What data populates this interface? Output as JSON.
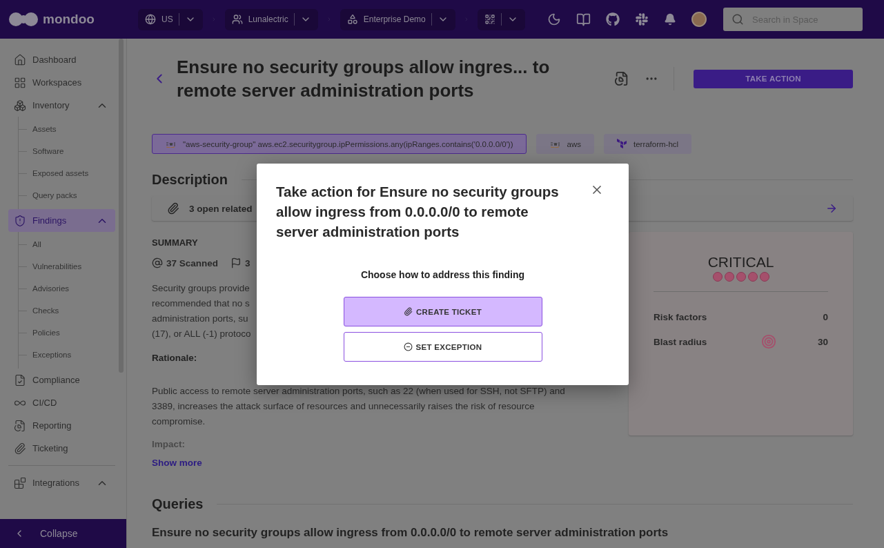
{
  "topbar": {
    "logo": "mondoo",
    "selectors": [
      {
        "kind": "labeled",
        "label": "US"
      },
      {
        "kind": "labeled",
        "label": "Lunalectric"
      },
      {
        "kind": "labeled",
        "label": "Enterprise Demo"
      },
      {
        "kind": "icon-only"
      }
    ],
    "search": {
      "placeholder": "Search in Space"
    }
  },
  "sidebar": {
    "items": [
      {
        "label": "Dashboard",
        "selected": false
      },
      {
        "label": "Workspaces",
        "selected": false
      },
      {
        "label": "Inventory",
        "selected": false,
        "expanded": true,
        "children": [
          {
            "label": "Assets",
            "selected": false
          },
          {
            "label": "Software",
            "selected": false
          },
          {
            "label": "Exposed assets",
            "selected": false
          },
          {
            "label": "Query packs",
            "selected": false
          }
        ]
      },
      {
        "label": "Findings",
        "selected": true,
        "expanded": true,
        "children": [
          {
            "label": "All",
            "selected": false
          },
          {
            "label": "Vulnerabilities",
            "selected": false
          },
          {
            "label": "Advisories",
            "selected": false
          },
          {
            "label": "Checks",
            "selected": false
          },
          {
            "label": "Policies",
            "selected": false
          },
          {
            "label": "Exceptions",
            "selected": false
          }
        ]
      },
      {
        "label": "Compliance",
        "selected": false
      },
      {
        "label": "CI/CD",
        "selected": false
      },
      {
        "label": "Reporting",
        "selected": false
      },
      {
        "label": "Ticketing",
        "selected": false
      },
      {
        "label": "Integrations",
        "selected": false,
        "expanded": true
      }
    ],
    "collapse": "Collapse"
  },
  "header": {
    "title": "Ensure no security groups allow ingres... to remote server administration ports",
    "action": "TAKE ACTION"
  },
  "tags": [
    {
      "label": "\"aws-security-group\" aws.ec2.securitygroup.ipPermissions.any(ipRanges.contains('0.0.0.0/0'))",
      "selected": true,
      "kind": "aws"
    },
    {
      "label": "aws",
      "selected": false,
      "kind": "aws"
    },
    {
      "label": "terraform-hcl",
      "selected": false,
      "kind": "terraform"
    }
  ],
  "description": {
    "heading": "Description",
    "related": "3 open related",
    "summary_label": "SUMMARY",
    "stats": [
      "37 Scanned",
      "3"
    ],
    "lines": [
      "Security groups provide",
      "recommended that no s",
      "administration ports, su",
      "(17), or ALL (-1) protoco"
    ],
    "rationale_label": "Rationale:",
    "rationale": [
      "Public access to remote server administration ports, such as 22 (when used for SSH, not SFTP) and",
      "3389, increases the attack surface of resources and unnecessarily raises the risk of resource",
      "compromise."
    ],
    "impact_label": "Impact:",
    "show_more": "Show more"
  },
  "risk": {
    "severity": "CRITICAL",
    "rows": [
      {
        "label": "Risk factors",
        "value": "0",
        "kind": "plain"
      },
      {
        "label": "Blast radius",
        "value": "30",
        "kind": "target"
      }
    ]
  },
  "queries": {
    "heading": "Queries",
    "first": "Ensure no security groups allow ingress from 0.0.0.0/0 to remote server administration ports"
  },
  "modal": {
    "title": "Take action for Ensure no security groups allow ingress from 0.0.0.0/0 to remote server administration ports",
    "prompt": "Choose how to address this finding",
    "buttons": [
      {
        "label": "CREATE TICKET",
        "kind": "ticket",
        "selected": true
      },
      {
        "label": "SET EXCEPTION",
        "kind": "exception",
        "selected": false
      }
    ]
  }
}
